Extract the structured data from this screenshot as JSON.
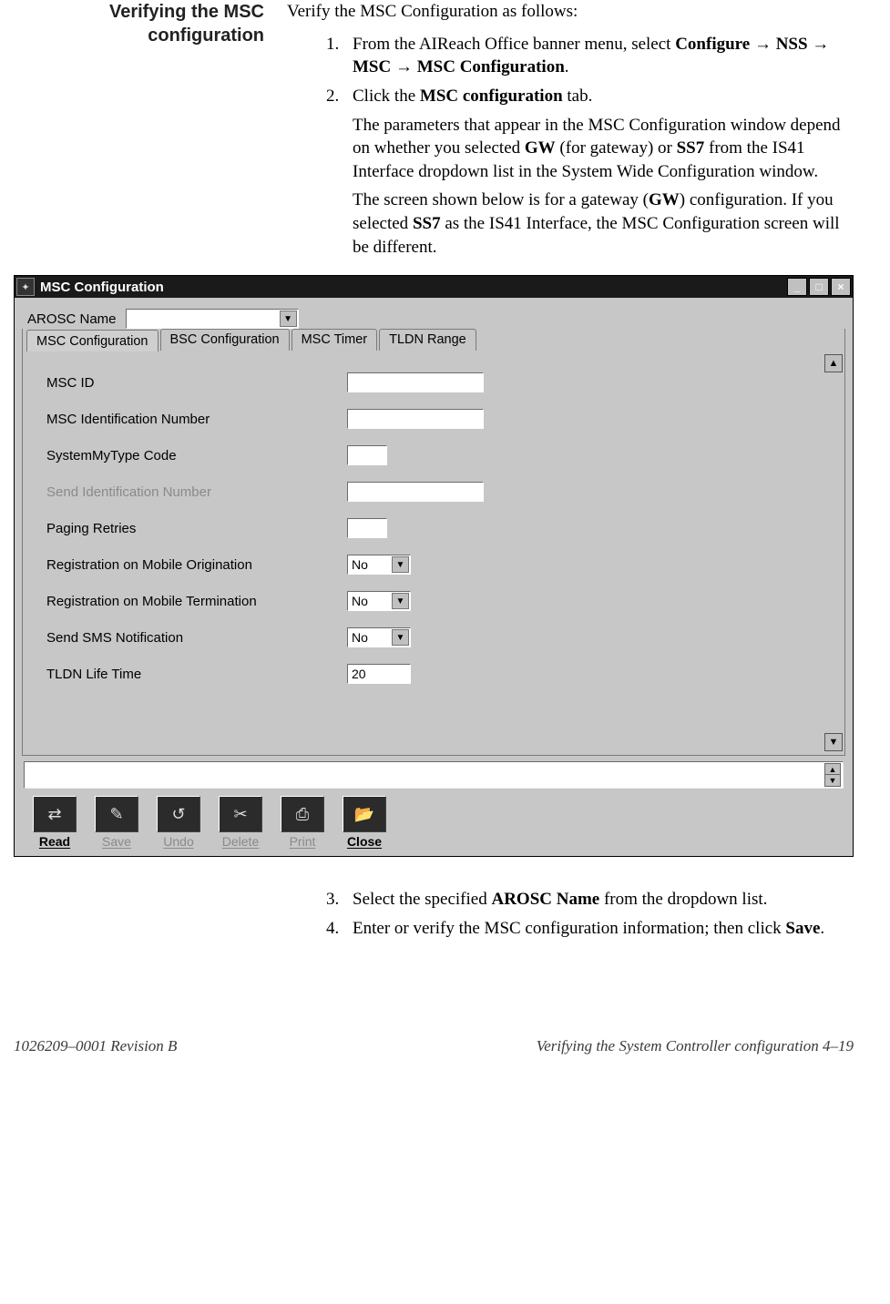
{
  "heading": "Verifying the MSC configuration",
  "intro": "Verify the MSC Configuration as follows:",
  "arrow": "→",
  "steps12": {
    "s1_pre": "From the AIReach Office banner menu, select ",
    "s1_b1": "Configure",
    "s1_b2": "NSS",
    "s1_b3": "MSC",
    "s1_b4": "MSC Configuration",
    "s1_post": ".",
    "s2_a": "Click the ",
    "s2_b": "MSC configuration",
    "s2_c": " tab.",
    "s2_p1a": "The parameters that appear in the MSC Configuration window depend on whether you selected ",
    "s2_p1b": "GW",
    "s2_p1c": " (for gateway) or ",
    "s2_p1d": "SS7",
    "s2_p1e": " from the IS41 Interface dropdown list in the System Wide Configuration window.",
    "s2_p2a": "The screen shown below is for a gateway (",
    "s2_p2b": "GW",
    "s2_p2c": ") configuration. If you selected ",
    "s2_p2d": "SS7",
    "s2_p2e": " as the IS41 Interface, the MSC Configuration screen will be different."
  },
  "steps34": {
    "s3_a": "Select the specified ",
    "s3_b": "AROSC Name",
    "s3_c": " from the dropdown list.",
    "s4_a": "Enter or verify the MSC configuration information; then click ",
    "s4_b": "Save",
    "s4_c": "."
  },
  "window": {
    "title": "MSC Configuration",
    "arosc_label": "AROSC Name",
    "arosc_value": "",
    "tabs": [
      "MSC Configuration",
      "BSC Configuration",
      "MSC Timer",
      "TLDN Range"
    ],
    "fields": {
      "msc_id": {
        "label": "MSC ID",
        "value": ""
      },
      "msc_idnum": {
        "label": "MSC Identification Number",
        "value": ""
      },
      "sysmytype": {
        "label": "SystemMyType Code",
        "value": ""
      },
      "send_idnum": {
        "label": "Send Identification Number",
        "value": ""
      },
      "paging": {
        "label": "Paging Retries",
        "value": ""
      },
      "reg_mo": {
        "label": "Registration on Mobile Origination",
        "value": "No"
      },
      "reg_mt": {
        "label": "Registration on Mobile Termination",
        "value": "No"
      },
      "sms": {
        "label": "Send SMS Notification",
        "value": "No"
      },
      "tldn": {
        "label": "TLDN Life Time",
        "value": "20"
      }
    },
    "toolbar": {
      "read": "Read",
      "save": "Save",
      "undo": "Undo",
      "delete": "Delete",
      "print": "Print",
      "close": "Close"
    }
  },
  "footer": {
    "left": "1026209–0001  Revision B",
    "right": "Verifying the System Controller configuration   4–19"
  }
}
